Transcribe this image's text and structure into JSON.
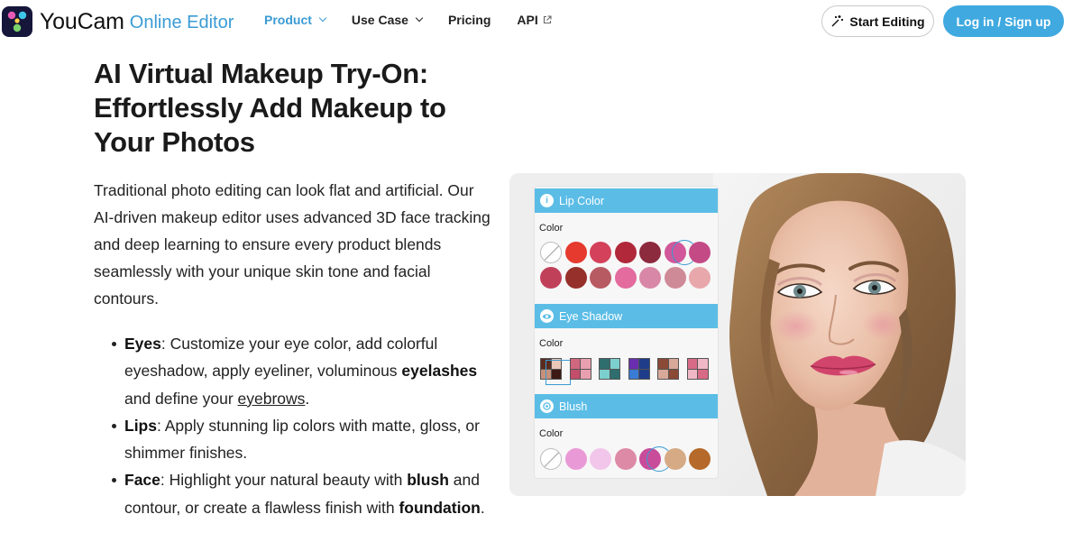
{
  "header": {
    "brand": "YouCam",
    "brand_sub": "Online Editor",
    "nav": [
      {
        "label": "Product",
        "active": true,
        "dropdown": true
      },
      {
        "label": "Use Case",
        "active": false,
        "dropdown": true
      },
      {
        "label": "Pricing",
        "active": false,
        "dropdown": false
      },
      {
        "label": "API",
        "active": false,
        "dropdown": false,
        "external": true
      }
    ],
    "start_label": "Start Editing",
    "login_label": "Log in / Sign up"
  },
  "main": {
    "title": "AI Virtual Makeup Try-On: Effortlessly Add Makeup to Your Photos",
    "intro": "Traditional photo editing can look flat and artificial. Our AI-driven makeup editor uses advanced 3D face tracking and deep learning to ensure every product blends seamlessly with your unique skin tone and facial contours.",
    "bullets": [
      {
        "term": "Eyes",
        "text_1": ": Customize your eye color, add colorful eyeshadow, apply eyeliner, voluminous ",
        "bold_1": "eyelashes",
        "text_2": " and define your ",
        "link": "eyebrows",
        "text_3": "."
      },
      {
        "term": "Lips",
        "text_1": ": Apply stunning lip colors with matte, gloss, or shimmer finishes."
      },
      {
        "term": "Face",
        "text_1": ": Highlight your natural beauty with ",
        "bold_1": "blush",
        "text_2": " and contour, or create a flawless finish with ",
        "bold_2": "foundation",
        "text_3": "."
      }
    ]
  },
  "panel": {
    "lip": {
      "title": "Lip Color",
      "label": "Color",
      "row1": [
        "none",
        "#e53a2d",
        "#d4415a",
        "#b0283a",
        "#8c2a3e",
        "#d1579a",
        "#c44a86"
      ],
      "row2": [
        "#c0405a",
        "#96302a",
        "#b85a62",
        "#e36b9e",
        "#d987a6",
        "#cf8a98",
        "#e8a7ab"
      ],
      "selected_row1_index": 5
    },
    "eye": {
      "title": "Eye Shadow",
      "label": "Color",
      "palettes": [
        [
          "#5a2b1e",
          "#e9c8b8",
          "#c8907a",
          "#3d1a14"
        ],
        [
          "#d0677f",
          "#e8a0b0",
          "#c24e6c",
          "#e8a0b0"
        ],
        [
          "#2e6e6e",
          "#7ccfcf",
          "#7ccfcf",
          "#2e6e6e"
        ],
        [
          "#6a2fb0",
          "#1f3c8a",
          "#3a7bd5",
          "#1f3c8a"
        ],
        [
          "#8a4a36",
          "#d8a898",
          "#d8a898",
          "#8a4a36"
        ],
        [
          "#d86a86",
          "#f0b8c6",
          "#f0b8c6",
          "#d86a86"
        ]
      ],
      "selected_index": 0
    },
    "blush": {
      "title": "Blush",
      "label": "Color",
      "swatches": [
        "none",
        "#e99ad6",
        "#f1c6ea",
        "#dd8aa6",
        "#c94c9a",
        "#d6aa84",
        "#b5692a"
      ],
      "selected_index": 4
    }
  },
  "icons": {
    "logo": "youcam-logo-icon",
    "start": "magic-wand-icon",
    "api": "external-link-icon",
    "lip": "info-icon",
    "eye": "eye-icon",
    "blush": "blush-icon"
  },
  "colors": {
    "accent": "#3fa9e0",
    "nav_active": "#3a9bd4",
    "panel_header": "#5bbde6"
  }
}
